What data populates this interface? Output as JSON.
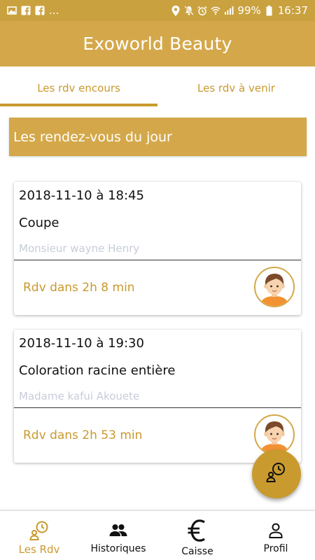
{
  "status_bar": {
    "battery": "99%",
    "time": "16:37",
    "more": "..."
  },
  "app": {
    "title": "Exoworld Beauty"
  },
  "tabs": [
    {
      "label": "Les rdv encours",
      "active": true
    },
    {
      "label": "Les rdv à venir",
      "active": false
    }
  ],
  "section": {
    "title": "Les rendez-vous du jour"
  },
  "appointments": [
    {
      "datetime": "2018-11-10 à 18:45",
      "service": "Coupe",
      "client": "Monsieur wayne Henry",
      "countdown": "Rdv dans 2h 8 min",
      "avatar_icon": "user-avatar-icon"
    },
    {
      "datetime": "2018-11-10 à 19:30",
      "service": "Coloration racine entière",
      "client": "Madame kafui Akouete",
      "countdown": "Rdv dans 2h 53 min",
      "avatar_icon": "user-avatar-icon"
    }
  ],
  "fab": {
    "icon": "person-clock-icon"
  },
  "bottom_nav": [
    {
      "label": "Les Rdv",
      "icon": "person-clock-icon",
      "active": true
    },
    {
      "label": "Historiques",
      "icon": "people-icon",
      "active": false
    },
    {
      "label": "Caisse",
      "icon": "euro-icon",
      "active": false
    },
    {
      "label": "Profil",
      "icon": "person-icon",
      "active": false
    }
  ],
  "colors": {
    "primary": "#d4a84a",
    "accent": "#c99a2e",
    "status_bar": "#c9a13f"
  }
}
